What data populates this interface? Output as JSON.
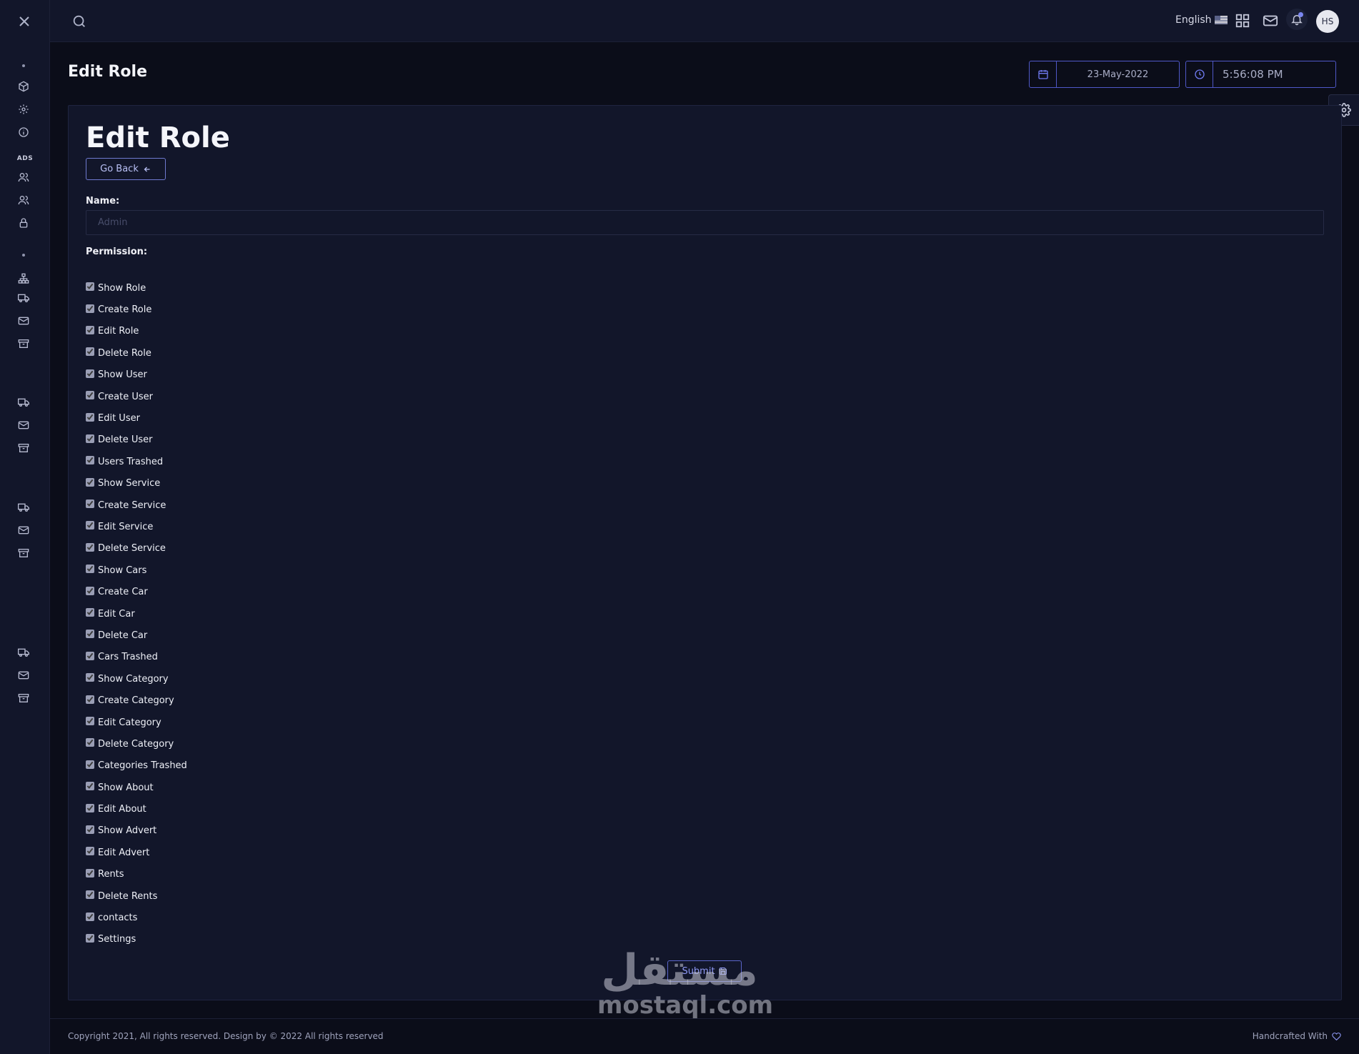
{
  "topbar": {
    "language": "English",
    "avatar_initials": "HS"
  },
  "sidebar": {
    "section_label": "ADS"
  },
  "page": {
    "title": "Edit Role",
    "date": "23-May-2022",
    "time": "5:56:08 PM"
  },
  "form": {
    "heading": "Edit Role",
    "go_back_label": "Go Back",
    "name_label": "Name:",
    "name_placeholder": "Admin",
    "permission_label": "Permission:",
    "permissions": [
      {
        "label": "Show Role",
        "checked": true
      },
      {
        "label": "Create Role",
        "checked": true
      },
      {
        "label": "Edit Role",
        "checked": true
      },
      {
        "label": "Delete Role",
        "checked": true
      },
      {
        "label": "Show User",
        "checked": true
      },
      {
        "label": "Create User",
        "checked": true
      },
      {
        "label": "Edit User",
        "checked": true
      },
      {
        "label": "Delete User",
        "checked": true
      },
      {
        "label": "Users Trashed",
        "checked": true
      },
      {
        "label": "Show Service",
        "checked": true
      },
      {
        "label": "Create Service",
        "checked": true
      },
      {
        "label": "Edit Service",
        "checked": true
      },
      {
        "label": "Delete Service",
        "checked": true
      },
      {
        "label": "Show Cars",
        "checked": true
      },
      {
        "label": "Create Car",
        "checked": true
      },
      {
        "label": "Edit Car",
        "checked": true
      },
      {
        "label": "Delete Car",
        "checked": true
      },
      {
        "label": "Cars Trashed",
        "checked": true
      },
      {
        "label": "Show Category",
        "checked": true
      },
      {
        "label": "Create Category",
        "checked": true
      },
      {
        "label": "Edit Category",
        "checked": true
      },
      {
        "label": "Delete Category",
        "checked": true
      },
      {
        "label": "Categories Trashed",
        "checked": true
      },
      {
        "label": "Show About",
        "checked": true
      },
      {
        "label": "Edit About",
        "checked": true
      },
      {
        "label": "Show Advert",
        "checked": true
      },
      {
        "label": "Edit Advert",
        "checked": true
      },
      {
        "label": "Rents",
        "checked": true
      },
      {
        "label": "Delete Rents",
        "checked": true
      },
      {
        "label": "contacts",
        "checked": true
      },
      {
        "label": "Settings",
        "checked": true
      }
    ],
    "submit_label": "Submit"
  },
  "watermark": {
    "arabic": "مستقل",
    "latin": "mostaql.com"
  },
  "footer": {
    "copyright": "Copyright 2021, All rights reserved. Design by © 2022 All rights reserved",
    "credit": "Handcrafted With"
  }
}
